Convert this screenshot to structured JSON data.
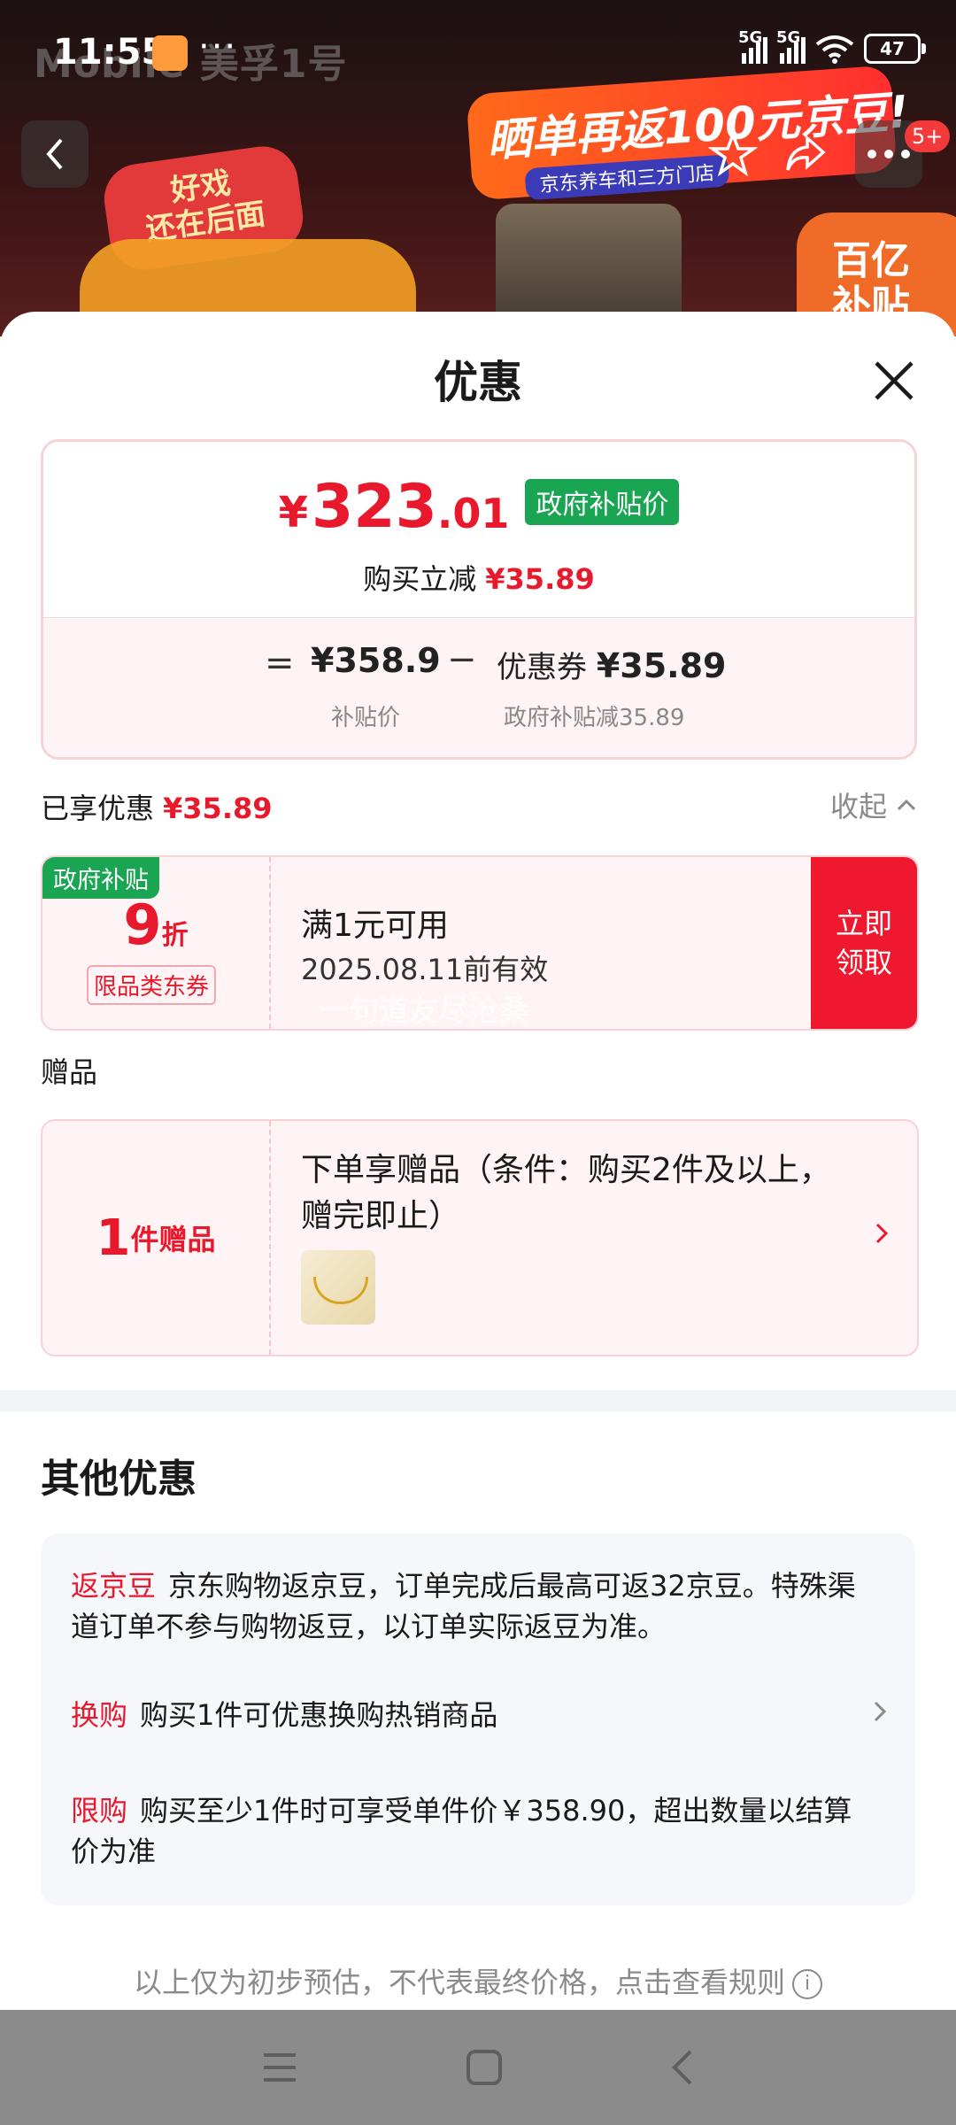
{
  "status_bar": {
    "time": "11:55",
    "carrier_watermark": "Mobile 美孚1号",
    "more": "···",
    "signal1_label": "5G",
    "signal2_label": "5G",
    "wifi_sub": "6",
    "battery": "47"
  },
  "background": {
    "badge_left": "好戏\n还在后面",
    "banner_title": "晒单再返100元京豆!",
    "banner_sub": "京东养车和三方门店",
    "badge_right": "百亿\n补贴",
    "notification_count": "5+"
  },
  "sheet": {
    "title": "优惠",
    "price": {
      "symbol": "¥",
      "integer": "323",
      "decimal": ".01",
      "tag": "政府补贴价",
      "instant_label": "购买立减",
      "instant_value": "¥35.89",
      "eq": "=",
      "base_value": "¥358.9",
      "base_label": "补贴价",
      "minus": "−",
      "coupon_prefix": "优惠券",
      "coupon_value": "¥35.89",
      "coupon_label": "政府补贴减35.89"
    },
    "enjoyed": {
      "label": "已享优惠",
      "value": "¥35.89",
      "collapse": "收起"
    },
    "coupon": {
      "tag": "政府补贴",
      "discount": "9",
      "discount_unit": "折",
      "type": "限品类东券",
      "condition": "满1元可用",
      "validity": "2025.08.11前有效",
      "button_line1": "立即",
      "button_line2": "领取"
    },
    "watermark": "一句道友尽沧桑",
    "gift_section": {
      "label": "赠品",
      "count": "1",
      "count_unit": "件赠品",
      "title": "下单享赠品（条件：购买2件及以上，赠完即止）"
    },
    "other": {
      "title": "其他优惠",
      "items": [
        {
          "key": "返京豆",
          "text": "京东购物返京豆，订单完成后最高可返32京豆。特殊渠道订单不参与购物返豆，以订单实际返豆为准。"
        },
        {
          "key": "换购",
          "text": "购买1件可优惠换购热销商品"
        },
        {
          "key": "限购",
          "text": "购买至少1件时可享受单件价￥358.90，超出数量以结算价为准"
        }
      ]
    },
    "disclaimer": "以上仅为初步预估，不代表最终价格，点击查看规则"
  },
  "colors": {
    "accent_red": "#e8192c",
    "gov_green": "#1aa552",
    "button_red": "#f0182e"
  },
  "icons": [
    "back-icon",
    "star-icon",
    "share-icon",
    "more-icon",
    "close-icon",
    "chevron-up-icon",
    "chevron-right-icon",
    "info-icon",
    "menu-icon",
    "home-icon",
    "nav-back-icon"
  ]
}
